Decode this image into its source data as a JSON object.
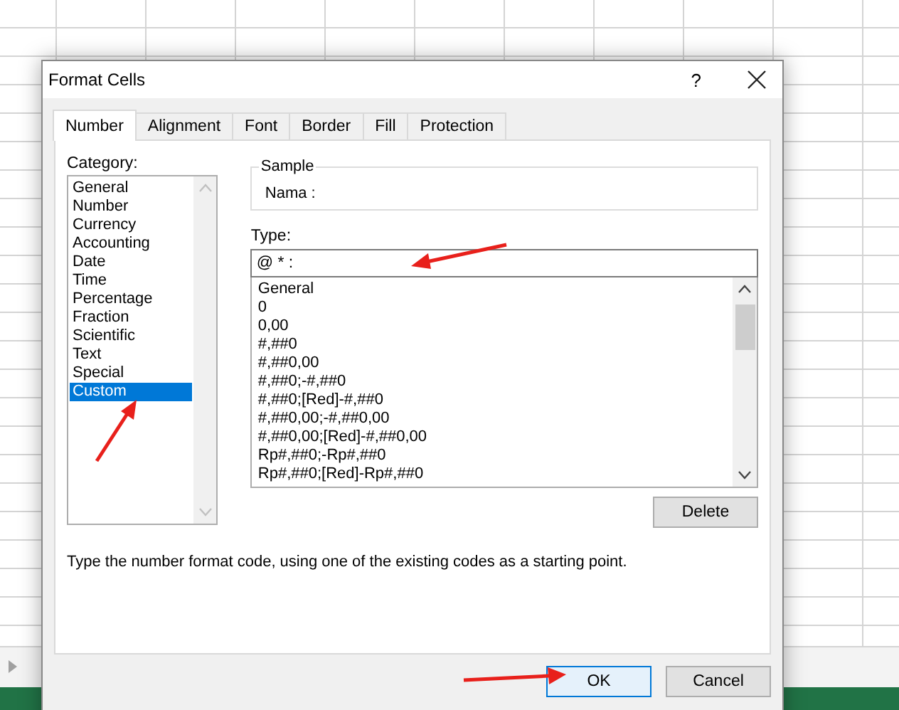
{
  "window": {
    "title": "Format Cells",
    "help_button": "?"
  },
  "tabs": [
    {
      "label": "Number",
      "selected": true
    },
    {
      "label": "Alignment",
      "selected": false
    },
    {
      "label": "Font",
      "selected": false
    },
    {
      "label": "Border",
      "selected": false
    },
    {
      "label": "Fill",
      "selected": false
    },
    {
      "label": "Protection",
      "selected": false
    }
  ],
  "category": {
    "label": "Category:",
    "items": [
      {
        "label": "General",
        "selected": false
      },
      {
        "label": "Number",
        "selected": false
      },
      {
        "label": "Currency",
        "selected": false
      },
      {
        "label": "Accounting",
        "selected": false
      },
      {
        "label": "Date",
        "selected": false
      },
      {
        "label": "Time",
        "selected": false
      },
      {
        "label": "Percentage",
        "selected": false
      },
      {
        "label": "Fraction",
        "selected": false
      },
      {
        "label": "Scientific",
        "selected": false
      },
      {
        "label": "Text",
        "selected": false
      },
      {
        "label": "Special",
        "selected": false
      },
      {
        "label": "Custom",
        "selected": true
      }
    ]
  },
  "sample": {
    "label": "Sample",
    "value": "Nama :"
  },
  "type": {
    "label": "Type:",
    "value": "@ * :",
    "formats": [
      "General",
      "0",
      "0,00",
      "#,##0",
      "#,##0,00",
      "#,##0;-#,##0",
      "#,##0;[Red]-#,##0",
      "#,##0,00;-#,##0,00",
      "#,##0,00;[Red]-#,##0,00",
      "Rp#,##0;-Rp#,##0",
      "Rp#,##0;[Red]-Rp#,##0"
    ]
  },
  "delete_button": "Delete",
  "hint": "Type the number format code, using one of the existing codes as a starting point.",
  "buttons": [
    {
      "label": "OK",
      "default": true
    },
    {
      "label": "Cancel",
      "default": false
    }
  ]
}
